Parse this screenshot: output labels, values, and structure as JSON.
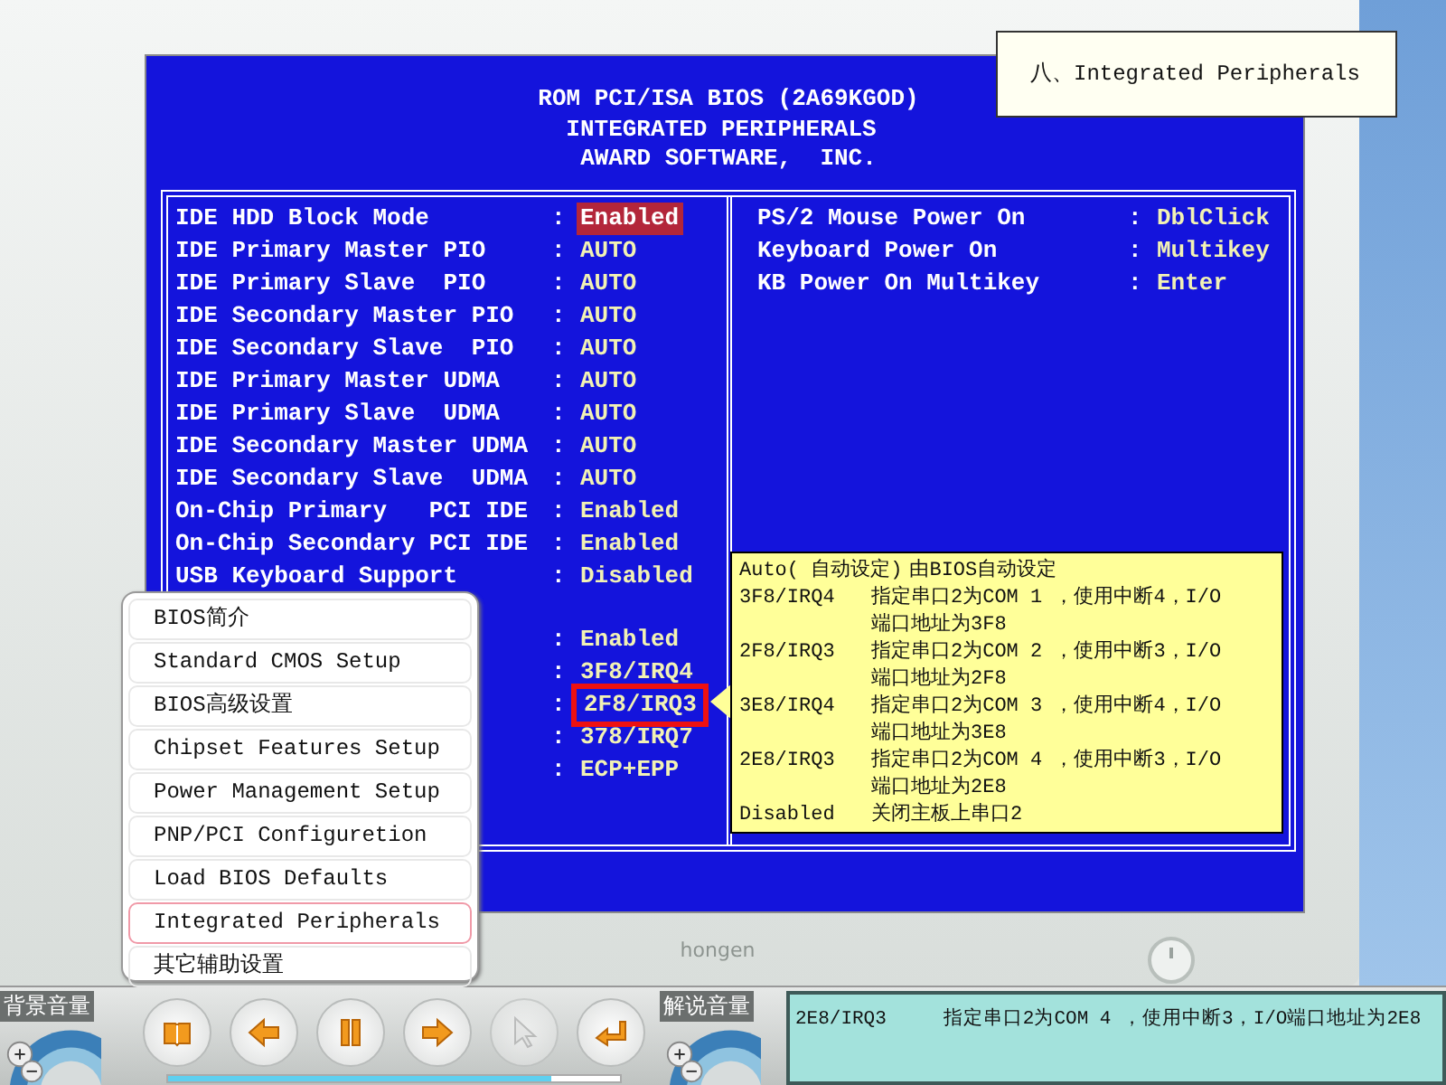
{
  "caption": "八、Integrated Peripherals",
  "bios": {
    "header": [
      "ROM PCI/ISA BIOS (2A69KGOD)",
      "INTEGRATED PERIPHERALS",
      "AWARD SOFTWARE,  INC."
    ],
    "left_rows": [
      {
        "label": "IDE HDD Block Mode",
        "separator": ":",
        "value": "Enabled",
        "selected": true,
        "outlined": false
      },
      {
        "label": "IDE Primary Master PIO",
        "separator": ":",
        "value": "AUTO",
        "selected": false,
        "outlined": false
      },
      {
        "label": "IDE Primary Slave  PIO",
        "separator": ":",
        "value": "AUTO",
        "selected": false,
        "outlined": false
      },
      {
        "label": "IDE Secondary Master PIO",
        "separator": ":",
        "value": "AUTO",
        "selected": false,
        "outlined": false
      },
      {
        "label": "IDE Secondary Slave  PIO",
        "separator": ":",
        "value": "AUTO",
        "selected": false,
        "outlined": false
      },
      {
        "label": "IDE Primary Master UDMA",
        "separator": ":",
        "value": "AUTO",
        "selected": false,
        "outlined": false
      },
      {
        "label": "IDE Primary Slave  UDMA",
        "separator": ":",
        "value": "AUTO",
        "selected": false,
        "outlined": false
      },
      {
        "label": "IDE Secondary Master UDMA",
        "separator": ":",
        "value": "AUTO",
        "selected": false,
        "outlined": false
      },
      {
        "label": "IDE Secondary Slave  UDMA",
        "separator": ":",
        "value": "AUTO",
        "selected": false,
        "outlined": false
      },
      {
        "label": "On-Chip Primary   PCI IDE",
        "separator": ":",
        "value": "Enabled",
        "selected": false,
        "outlined": false
      },
      {
        "label": "On-Chip Secondary PCI IDE",
        "separator": ":",
        "value": "Enabled",
        "selected": false,
        "outlined": false
      },
      {
        "label": "USB Keyboard Support",
        "separator": ":",
        "value": "Disabled",
        "selected": false,
        "outlined": false
      },
      {
        "kind": "blank"
      },
      {
        "separator": ":",
        "value": "Enabled",
        "selected": false,
        "outlined": false
      },
      {
        "separator": ":",
        "value": "3F8/IRQ4",
        "selected": false,
        "outlined": false
      },
      {
        "separator": ":",
        "value": "2F8/IRQ3",
        "selected": false,
        "outlined": true
      },
      {
        "separator": ":",
        "value": "378/IRQ7",
        "selected": false,
        "outlined": false
      },
      {
        "separator": ":",
        "value": "ECP+EPP",
        "selected": false,
        "outlined": false
      }
    ],
    "right_rows": [
      {
        "label": "PS/2 Mouse Power On",
        "separator": ":",
        "value": "DblClick"
      },
      {
        "label": "Keyboard Power On",
        "separator": ":",
        "value": "Multikey"
      },
      {
        "label": "KB Power On Multikey",
        "separator": ":",
        "value": "Enter"
      }
    ]
  },
  "help_popup": [
    {
      "code": "Auto( 自动设定)",
      "lines": [
        "由BIOS自动设定"
      ]
    },
    {
      "code": "3F8/IRQ4",
      "lines": [
        "指定串口2为COM 1 ，使用中断4，I/O",
        "端口地址为3F8"
      ]
    },
    {
      "code": "2F8/IRQ3",
      "lines": [
        "指定串口2为COM 2 ，使用中断3，I/O",
        "端口地址为2F8"
      ]
    },
    {
      "code": "3E8/IRQ4",
      "lines": [
        "指定串口2为COM 3 ，使用中断4，I/O",
        "端口地址为3E8"
      ]
    },
    {
      "code": "2E8/IRQ3",
      "lines": [
        "指定串口2为COM 4 ，使用中断3，I/O",
        "端口地址为2E8"
      ]
    },
    {
      "code": "Disabled",
      "lines": [
        "关闭主板上串口2"
      ]
    }
  ],
  "menu": [
    {
      "label": "BIOS简介",
      "selected": false
    },
    {
      "label": "Standard CMOS Setup",
      "selected": false
    },
    {
      "label": "BIOS高级设置",
      "selected": false
    },
    {
      "label": "Chipset Features Setup",
      "selected": false
    },
    {
      "label": "Power Management Setup",
      "selected": false
    },
    {
      "label": "PNP/PCI Configuretion",
      "selected": false
    },
    {
      "label": "Load BIOS Defaults",
      "selected": false
    },
    {
      "label": "Integrated Peripherals",
      "selected": true
    },
    {
      "label": "其它辅助设置",
      "selected": false
    }
  ],
  "monitor": {
    "brand": "hongen"
  },
  "toolbar": {
    "left_label": "背景音量",
    "right_label": "解说音量",
    "buttons": [
      {
        "kind": "book",
        "disabled": false
      },
      {
        "kind": "back",
        "disabled": false
      },
      {
        "kind": "pause",
        "disabled": false
      },
      {
        "kind": "forward",
        "disabled": false
      },
      {
        "kind": "pointer",
        "disabled": true
      },
      {
        "kind": "return",
        "disabled": false
      }
    ],
    "progress": {
      "level": 0.85
    },
    "subtitle": "2E8/IRQ3     指定串口2为COM 4 ，使用中断3，I/O端口地址为2E8"
  }
}
